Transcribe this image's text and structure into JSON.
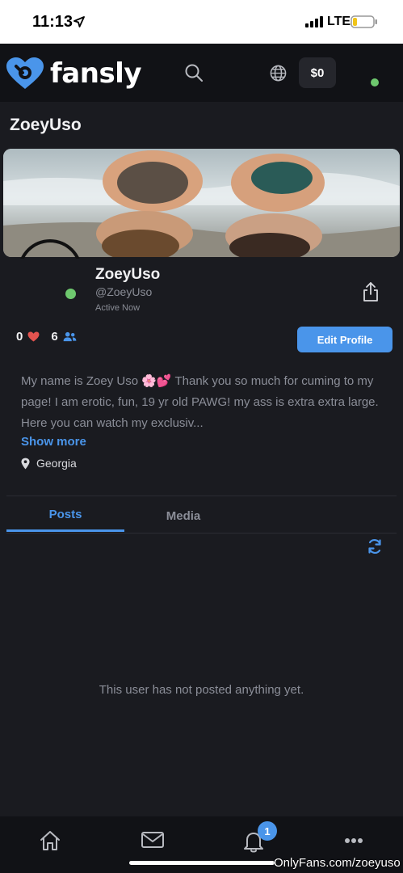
{
  "status_bar": {
    "time": "11:13",
    "network": "LTE"
  },
  "header": {
    "logo_text": "fansly",
    "wallet_label": "$0",
    "brand_color": "#4a95ea"
  },
  "page": {
    "title": "ZoeyUso"
  },
  "profile": {
    "name": "ZoeyUso",
    "handle": "@ZoeyUso",
    "status": "Active Now",
    "likes": "0",
    "followers": "6",
    "edit_label": "Edit Profile",
    "bio_part1": "My name is Zoey Uso ",
    "bio_emoji": "🌸💕",
    "bio_part2": " Thank you so much for cuming to my page! I am erotic, fun, 19 yr old PAWG! my ass is extra extra large.  Here you can watch my exclusiv...",
    "show_more": "Show more",
    "location": "Georgia"
  },
  "tabs": [
    {
      "label": "Posts",
      "active": true
    },
    {
      "label": "Media",
      "active": false
    }
  ],
  "feed": {
    "empty_message": "This user has not posted anything yet."
  },
  "bottom_nav": {
    "items": [
      "home-icon",
      "mail-icon",
      "bell-icon",
      "more-icon"
    ],
    "notification_count": "1"
  },
  "watermark": "OnlyFans.com/zoeyuso"
}
